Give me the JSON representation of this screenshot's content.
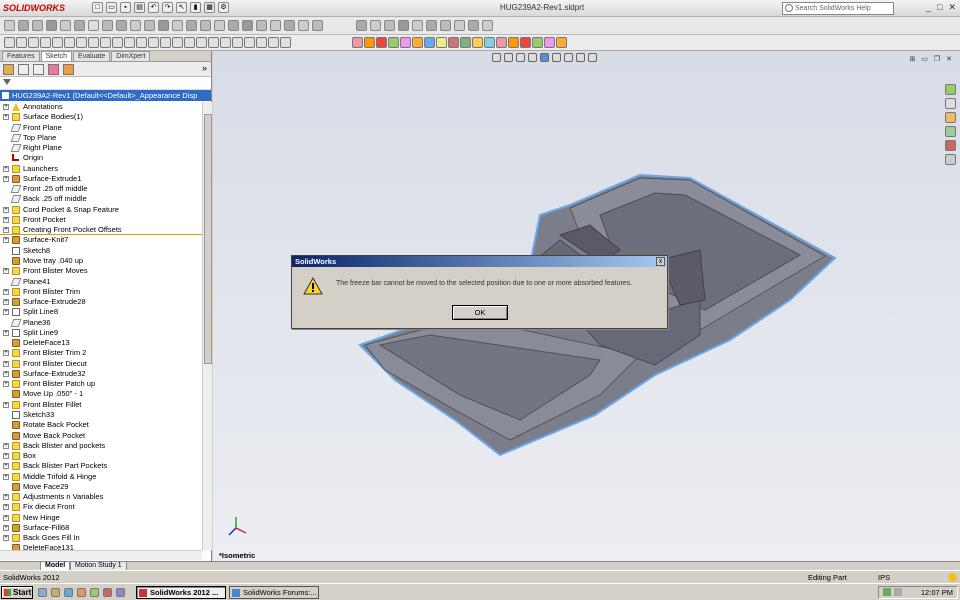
{
  "app": {
    "logo": "SOLIDWORKS",
    "document_title": "HUG239A2-Rev1.sldprt",
    "search_placeholder": "Search SolidWorks Help",
    "window_controls": [
      "_",
      "□",
      "✕"
    ]
  },
  "feature_manager": {
    "tabs": [
      "Features",
      "Sketch",
      "Evaluate",
      "DimXpert"
    ],
    "active_tab": "Sketch",
    "root": "HUG239A2-Rev1  (Default<<Default>_Appearance Disp",
    "items": [
      {
        "label": "Annotations",
        "icon": "warn",
        "expand": true
      },
      {
        "label": "Surface Bodies(1)",
        "icon": "folder",
        "expand": true
      },
      {
        "label": "Front Plane",
        "icon": "plane",
        "expand": false
      },
      {
        "label": "Top Plane",
        "icon": "plane",
        "expand": false
      },
      {
        "label": "Right Plane",
        "icon": "plane",
        "expand": false
      },
      {
        "label": "Origin",
        "icon": "origin",
        "expand": false
      },
      {
        "label": "Launchers",
        "icon": "folder",
        "expand": true
      },
      {
        "label": "Surface-Extrude1",
        "icon": "feat",
        "expand": true
      },
      {
        "label": "Front .25 off middle",
        "icon": "plane",
        "expand": false
      },
      {
        "label": "Back .25 off middle",
        "icon": "plane",
        "expand": false
      },
      {
        "label": "Cord Pocket & Snap Feature",
        "icon": "folder",
        "expand": true
      },
      {
        "label": "Front Pocket",
        "icon": "folder",
        "expand": true
      },
      {
        "label": "Creating Front Pocket Offsets",
        "icon": "folder",
        "expand": true,
        "rollback": true
      },
      {
        "label": "Surface-Knit7",
        "icon": "feat",
        "expand": true
      },
      {
        "label": "Sketch8",
        "icon": "sketch",
        "expand": false
      },
      {
        "label": "Move tray .040 up",
        "icon": "feat",
        "expand": false
      },
      {
        "label": "Front Blister Moves",
        "icon": "folder",
        "expand": true
      },
      {
        "label": "Plane41",
        "icon": "plane",
        "expand": false
      },
      {
        "label": "Front Blister Trim",
        "icon": "folder",
        "expand": true
      },
      {
        "label": "Surface-Extrude28",
        "icon": "feat",
        "expand": true
      },
      {
        "label": "Split Line8",
        "icon": "sketch",
        "expand": true
      },
      {
        "label": "Plane36",
        "icon": "plane",
        "expand": false
      },
      {
        "label": "Split Line9",
        "icon": "sketch",
        "expand": true
      },
      {
        "label": "DeleteFace13",
        "icon": "feat",
        "expand": false
      },
      {
        "label": "Front Blister Trim 2",
        "icon": "folder",
        "expand": true
      },
      {
        "label": "Front Blister Diecut",
        "icon": "folder",
        "expand": true
      },
      {
        "label": "Surface-Extrude32",
        "icon": "feat",
        "expand": true
      },
      {
        "label": "Front Blister Patch up",
        "icon": "folder",
        "expand": true
      },
      {
        "label": "Move Up .050\" - 1",
        "icon": "feat",
        "expand": false
      },
      {
        "label": "Front Blister Fillet",
        "icon": "folder",
        "expand": true
      },
      {
        "label": "Sketch33",
        "icon": "sketch",
        "expand": false
      },
      {
        "label": "Rotate Back Pocket",
        "icon": "feat",
        "expand": false
      },
      {
        "label": "Move Back Pocket",
        "icon": "feat",
        "expand": false
      },
      {
        "label": "Back Blister and pockets",
        "icon": "folder",
        "expand": true
      },
      {
        "label": "Box",
        "icon": "folder",
        "expand": true
      },
      {
        "label": "Back Blister Part Pockets",
        "icon": "folder",
        "expand": true
      },
      {
        "label": "Middle Trifold & Hinge",
        "icon": "folder",
        "expand": true
      },
      {
        "label": "Move Face29",
        "icon": "feat",
        "expand": false
      },
      {
        "label": "Adjustments n Variables",
        "icon": "folder",
        "expand": true
      },
      {
        "label": "Fix diecut Front",
        "icon": "folder",
        "expand": true
      },
      {
        "label": "New Hinge",
        "icon": "folder",
        "expand": true
      },
      {
        "label": "Surface-Fill68",
        "icon": "feat",
        "expand": true
      },
      {
        "label": "Back Goes Fill In",
        "icon": "folder",
        "expand": true
      },
      {
        "label": "DeleteFace131",
        "icon": "feat",
        "expand": false
      }
    ]
  },
  "viewport": {
    "view_label": "*Isometric",
    "model_color": "#7a7b88",
    "bg_top": "#d8dce6"
  },
  "dialog": {
    "title": "SolidWorks",
    "message": "The freeze bar cannot be moved to the selected position due to one or more absorbed features.",
    "ok_label": "OK",
    "close_label": "x"
  },
  "bottom_tabs": [
    "Model",
    "Motion Study 1"
  ],
  "status": {
    "left": "SolidWorks 2012",
    "mode": "Editing Part",
    "units": "IPS"
  },
  "taskbar": {
    "start_label": "Start",
    "tasks": [
      {
        "label": "SolidWorks 2012 ...",
        "active": true
      },
      {
        "label": "SolidWorks Forums:...",
        "active": false
      }
    ],
    "clock": "12:07 PM"
  }
}
